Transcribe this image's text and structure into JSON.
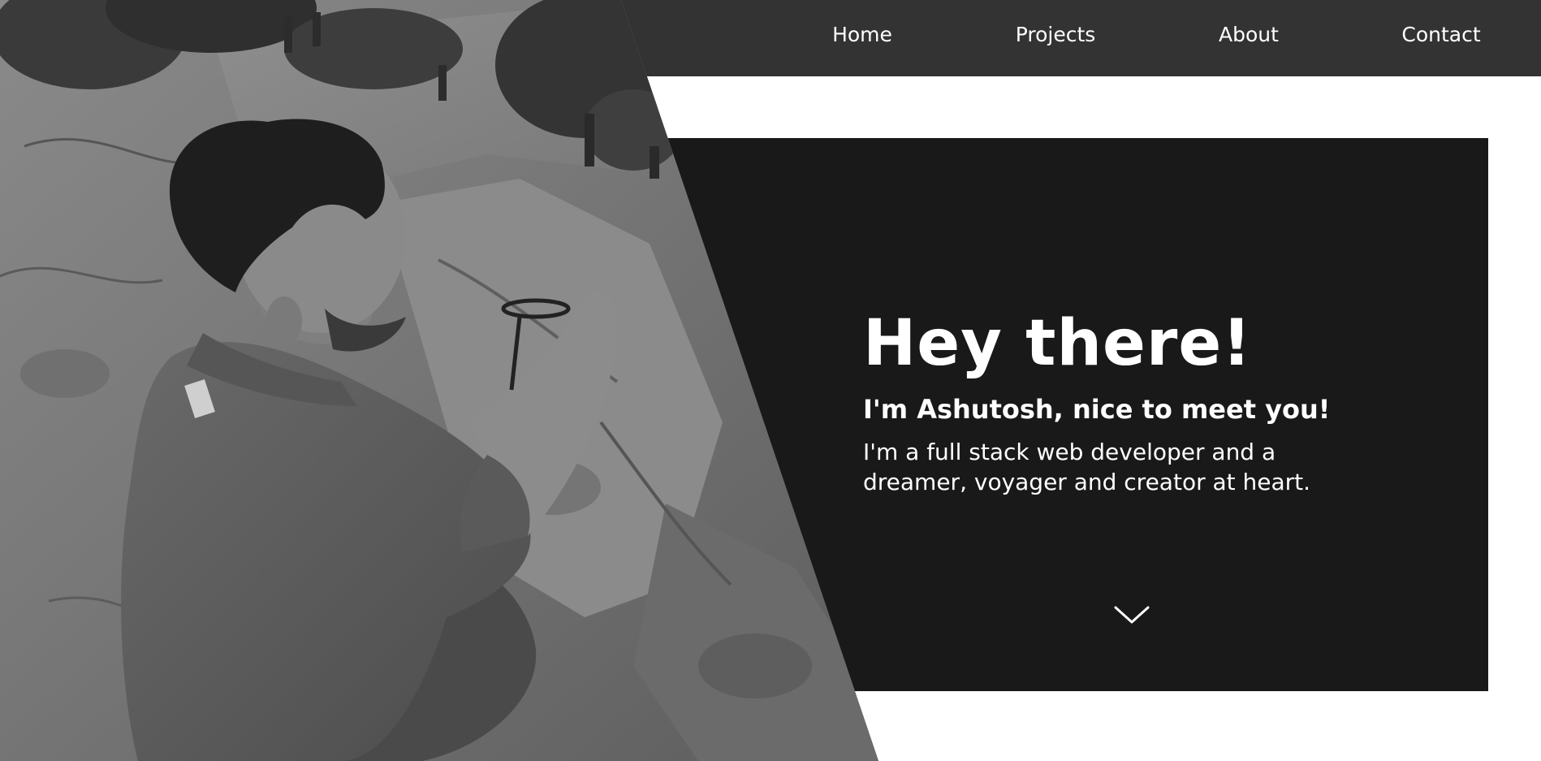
{
  "nav": {
    "items": [
      {
        "label": "Home"
      },
      {
        "label": "Projects"
      },
      {
        "label": "About"
      },
      {
        "label": "Contact"
      }
    ]
  },
  "hero": {
    "title": "Hey there!",
    "subtitle": "I'm Ashutosh, nice to meet you!",
    "description": "I'm a full stack web developer and a dreamer, voyager and creator at heart."
  },
  "icons": {
    "scroll": "chevron-down-icon"
  },
  "colors": {
    "navbar": "#333333",
    "card": "#191919",
    "text": "#ffffff",
    "page": "#ffffff"
  }
}
